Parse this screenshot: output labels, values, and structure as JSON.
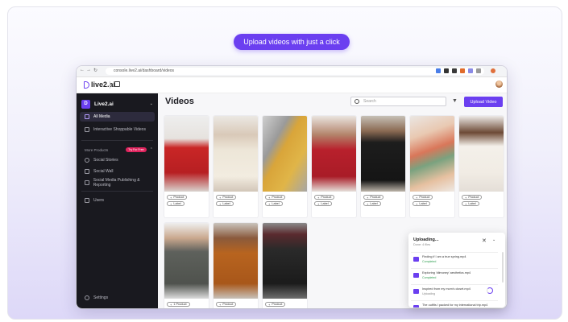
{
  "hero": {
    "cta_label": "Upload videos with just a click"
  },
  "browser": {
    "url": "console.live2.ai/dashboard/videos",
    "nav": [
      "←",
      "→",
      "↻"
    ]
  },
  "app": {
    "logo_text": "live2.ai",
    "workspace": {
      "initial": "D",
      "name": "Live2.ai"
    },
    "sidebar": {
      "items": [
        {
          "label": "All Media"
        },
        {
          "label": "Interactive Shoppable Videos"
        }
      ],
      "more_products": {
        "label": "More Products",
        "badge": "Try For Free"
      },
      "more_items": [
        {
          "label": "Social Stories"
        },
        {
          "label": "Social Wall"
        },
        {
          "label": "Social Media Publishing & Reporting"
        },
        {
          "label": "Users"
        }
      ],
      "settings": {
        "label": "Settings"
      }
    },
    "main": {
      "title": "Videos",
      "search_placeholder": "Search",
      "upload_button": "Upload Video",
      "card_tags": {
        "product": "Product",
        "label": "Label",
        "product_count": "1 Product"
      }
    },
    "uploader": {
      "title": "Uploading...",
      "subtitle": "Done: 4 files",
      "files": [
        {
          "name": "Finding if I am a true spring.mp4",
          "status": "Completed",
          "status_color": "#2e9e4f"
        },
        {
          "name": "Exploring 'dilmoney' aesthetics.mp4",
          "status": "Completed",
          "status_color": "#2e9e4f"
        },
        {
          "name": "Inspired from my mom's closet.mp4",
          "status": "Uploading",
          "status_color": "#888888"
        },
        {
          "name": "The outfits I packed for my international trip.mp4",
          "status": "",
          "status_color": "#888888"
        }
      ]
    }
  },
  "colors": {
    "accent": "#6b3ff0",
    "sidebar": "#19191f"
  },
  "icons": [
    "search-icon",
    "filter-icon",
    "settings-icon",
    "close-icon",
    "chevron-down-icon",
    "video-file-icon",
    "spinner-icon"
  ]
}
